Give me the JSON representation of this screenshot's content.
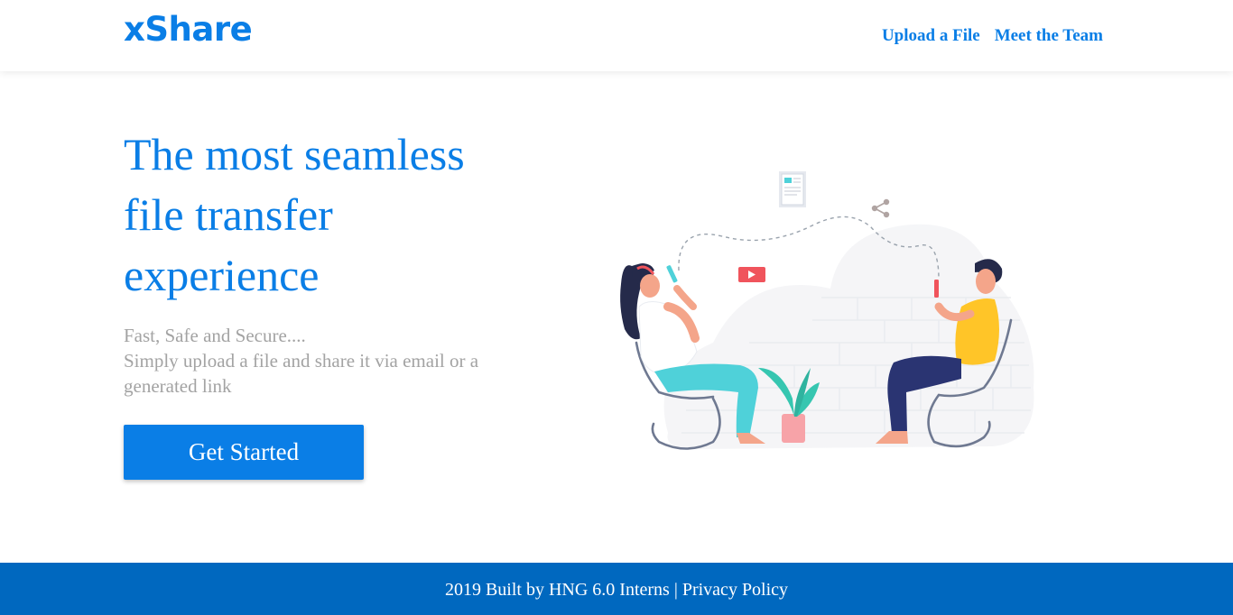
{
  "brand": {
    "logo_text": "xShare",
    "primary_color": "#0a7ee6",
    "footer_color": "#0068bf"
  },
  "nav": {
    "items": [
      {
        "label": "Upload a File"
      },
      {
        "label": "Meet the Team"
      }
    ]
  },
  "hero": {
    "title": "The most seamless file transfer experience",
    "subtitle_line1": "Fast, Safe and Secure....",
    "subtitle_line2": "Simply upload a file and share it via email or a generated link",
    "cta_label": "Get Started"
  },
  "illustration": {
    "icons": [
      "document-icon",
      "share-icon",
      "play-icon",
      "phone-icon",
      "plant-icon"
    ]
  },
  "footer": {
    "text": "2019 Built by HNG 6.0 Interns",
    "separator": "|",
    "privacy_label": "Privacy Policy"
  }
}
